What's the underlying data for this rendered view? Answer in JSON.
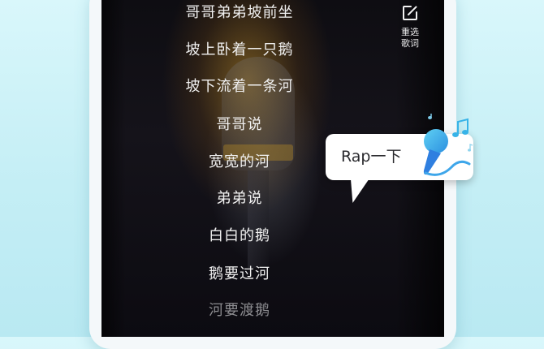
{
  "reselect": {
    "label": "重选\n歌词",
    "icon": "edit-icon"
  },
  "lyrics": [
    {
      "text": "哥哥弟弟坡前坐"
    },
    {
      "text": "坡上卧着一只鹅"
    },
    {
      "text": "坡下流着一条河"
    },
    {
      "text": "哥哥说"
    },
    {
      "text": "宽宽的河"
    },
    {
      "text": "弟弟说"
    },
    {
      "text": "白白的鹅"
    },
    {
      "text": "鹅要过河"
    },
    {
      "text": "河要渡鹅"
    }
  ],
  "rap": {
    "label": "Rap一下",
    "icon": "karaoke-mic-icon"
  },
  "colors": {
    "background": "#c9f0f6",
    "mic_accent": "#2f9fe6",
    "note_accent": "#37b3e8"
  }
}
